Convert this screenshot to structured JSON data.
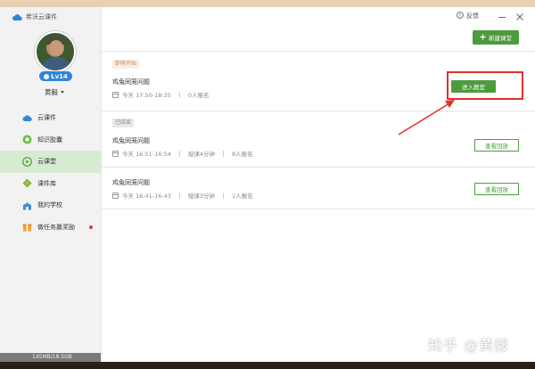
{
  "app": {
    "title": "希沃云课件"
  },
  "user": {
    "level": "Lv14",
    "name": "黄毅"
  },
  "sidebar": {
    "items": [
      {
        "label": "云课件",
        "icon": "cloud-doc-icon"
      },
      {
        "label": "知识胶囊",
        "icon": "capsule-icon"
      },
      {
        "label": "云课堂",
        "icon": "play-circle-icon",
        "active": true
      },
      {
        "label": "课件库",
        "icon": "diamond-library-icon"
      },
      {
        "label": "我的学校",
        "icon": "school-icon"
      },
      {
        "label": "做任务赢奖励",
        "icon": "gift-icon",
        "badge": true
      }
    ],
    "storage": "145MB/18.5GB"
  },
  "header": {
    "feedback": "反馈"
  },
  "toolbar": {
    "new_class": "新建课堂"
  },
  "sections": {
    "upcoming_label": "即将开始",
    "ended_label": "已结束"
  },
  "classes": [
    {
      "title": "鸡兔同笼问题",
      "time": "今天 17:50-18:35",
      "duration": "",
      "signups": "0人报名",
      "action": "进入教室"
    },
    {
      "title": "鸡兔同笼问题",
      "time": "今天 16:51-16:54",
      "duration": "授课4分钟",
      "signups": "8人报名",
      "action": "查看回放"
    },
    {
      "title": "鸡兔同笼问题",
      "time": "今天 16:41-16:43",
      "duration": "授课3分钟",
      "signups": "1人报名",
      "action": "查看回放"
    }
  ],
  "watermark": "知乎 @黄毅",
  "colors": {
    "accent": "#4d9b3e",
    "highlight": "#e0302a",
    "level_badge": "#2f86d7"
  }
}
